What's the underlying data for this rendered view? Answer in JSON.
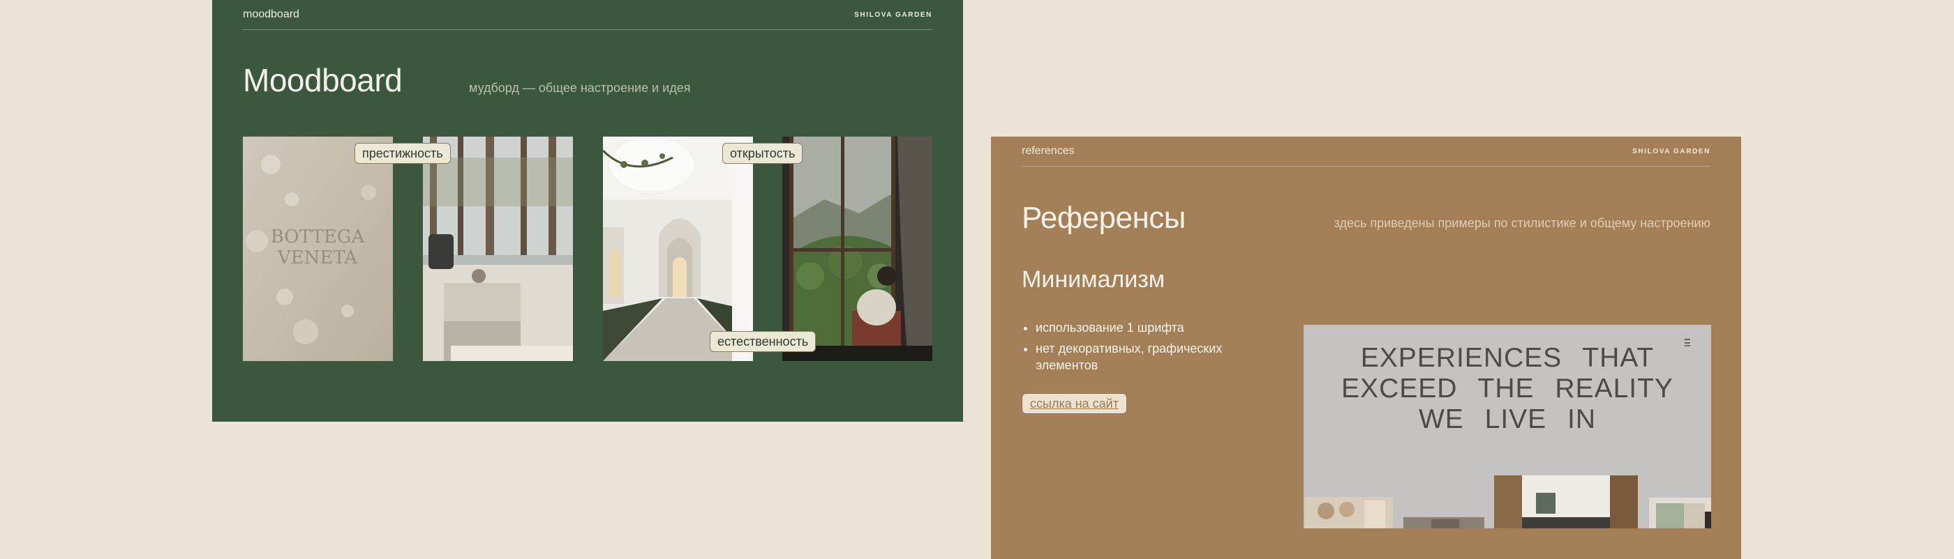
{
  "moodboard": {
    "header_left": "moodboard",
    "header_right": "SHILOVA GARDEN",
    "title": "Moodboard",
    "subtitle": "мудборд — общее настроение и идея",
    "tags": {
      "prestige": "престижность",
      "openness": "открытость",
      "naturalness": "естественность"
    },
    "photo1_text_line1": "BOTTEGA",
    "photo1_text_line2": "VENETA",
    "colors": {
      "background": "#3b573d",
      "pill": "#ece8d6"
    }
  },
  "references": {
    "header_left": "references",
    "header_right": "SHILOVA GARDEN",
    "title": "Референсы",
    "subtitle": "здесь приведены примеры по стилистике и общему настроению",
    "section_title": "Минимализм",
    "bullets": [
      "использование 1 шрифта",
      "нет декоративных, графических элементов"
    ],
    "link_label": "ссылка на сайт",
    "preview": {
      "headline_line1": "EXPERIENCES THAT",
      "headline_line2": "EXCEED THE REALITY",
      "headline_line3": "WE LIVE IN",
      "menu_icon": "hamburger-icon"
    },
    "colors": {
      "background": "#a37f57",
      "preview_bg": "#c4c3c1"
    }
  },
  "page": {
    "background": "#ebe3d6"
  }
}
